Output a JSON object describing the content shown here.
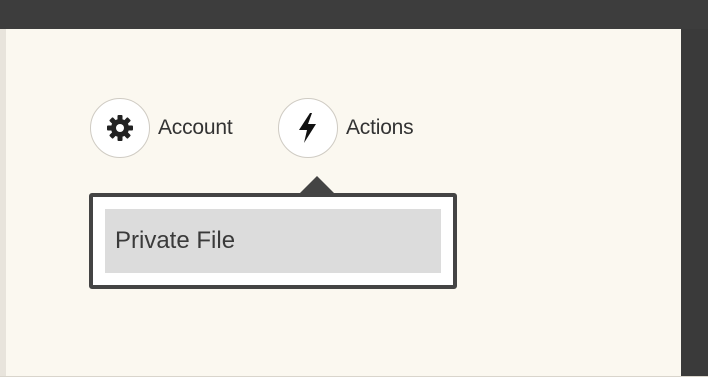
{
  "nav": {
    "account": {
      "label": "Account",
      "icon": "gear-icon"
    },
    "actions": {
      "label": "Actions",
      "icon": "lightning-bolt-icon"
    }
  },
  "dropdown": {
    "items": [
      {
        "label": "Private File"
      }
    ]
  },
  "colors": {
    "frame": "#3a3a3a",
    "content_bg": "#fbf8f0",
    "dropdown_border": "#444444",
    "item_highlight": "#dcdcdc",
    "icon_fill": "#222222"
  }
}
